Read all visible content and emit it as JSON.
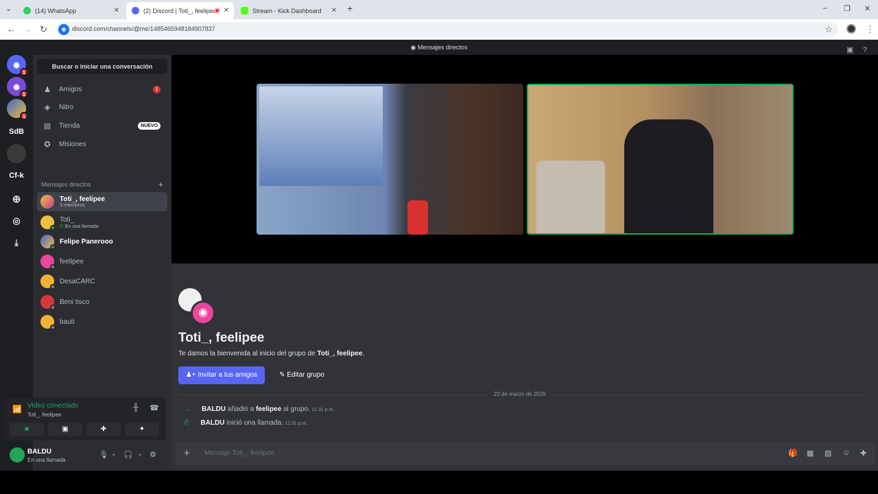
{
  "browser": {
    "tabs": [
      {
        "title": "(14) WhatsApp",
        "active": false
      },
      {
        "title": "(2) Discord | Toti_, feelipee",
        "active": true
      },
      {
        "title": "Stream - Kick Dashboard",
        "active": false
      }
    ],
    "url": "discord.com/channels/@me/1485465948184907837"
  },
  "discord": {
    "window_title": "Mensajes directos",
    "guilds": [
      {
        "label": "",
        "badge": "1",
        "color": "#5865f2"
      },
      {
        "label": "",
        "badge": "1",
        "color": "#7a4bd8"
      },
      {
        "label": "",
        "badge": "1",
        "color": "#3c63c9"
      },
      {
        "label": "SdB",
        "badge": "",
        "color": "#1e1f22"
      },
      {
        "label": "",
        "badge": "",
        "color": "#3a3a3a"
      },
      {
        "label": "Cf-k",
        "badge": "",
        "color": "#1e1f22"
      }
    ],
    "search_label": "Buscar o iniciar una conversación",
    "nav": [
      {
        "label": "Amigos",
        "badge": "1"
      },
      {
        "label": "Nitro",
        "badge": ""
      },
      {
        "label": "Tienda",
        "badge": "NUEVO"
      },
      {
        "label": "Misiones",
        "badge": ""
      }
    ],
    "dm_header": "Mensajes directos",
    "dms": [
      {
        "name": "Toti_, feelipee",
        "sub": "3 miembros",
        "color": "#c43c8e",
        "active": true
      },
      {
        "name": "Toti_",
        "sub": "En una llamada",
        "color": "#f0c040",
        "active": false
      },
      {
        "name": "Felipe Panerooo",
        "sub": "",
        "color": "#4b5fd6",
        "active": false
      },
      {
        "name": "feelipee",
        "sub": "",
        "color": "#eb459e",
        "active": false
      },
      {
        "name": "DesaCARC",
        "sub": "",
        "color": "#f0b232",
        "active": false
      },
      {
        "name": "Beni tisco",
        "sub": "",
        "color": "#da373c",
        "active": false
      },
      {
        "name": "bauti",
        "sub": "",
        "color": "#f0b232",
        "active": false
      }
    ],
    "voice": {
      "status": "Video conectado",
      "channel": "Toti_, feelipee"
    },
    "user": {
      "name": "BALDU",
      "status": "En una llamada"
    },
    "group": {
      "title": "Toti_, feelipee",
      "welcome_prefix": "Te damos la bienvenida al inicio del grupo de ",
      "welcome_name": "Toti_, feelipee",
      "welcome_suffix": ".",
      "invite_label": "Invitar a tus amigos",
      "edit_label": "Editar grupo"
    },
    "date_divider": "22 de marzo de 2026",
    "messages": [
      {
        "user": "BALDU",
        "text1": " añadió a ",
        "target": "feelipee",
        "text2": " al grupo. ",
        "time": "11:31 p.m."
      },
      {
        "user": "BALDU",
        "text1": " inició una llamada. ",
        "target": "",
        "text2": "",
        "time": "11:31 p.m."
      }
    ],
    "composer_placeholder": "Mensaje Toti_, feelipee"
  }
}
